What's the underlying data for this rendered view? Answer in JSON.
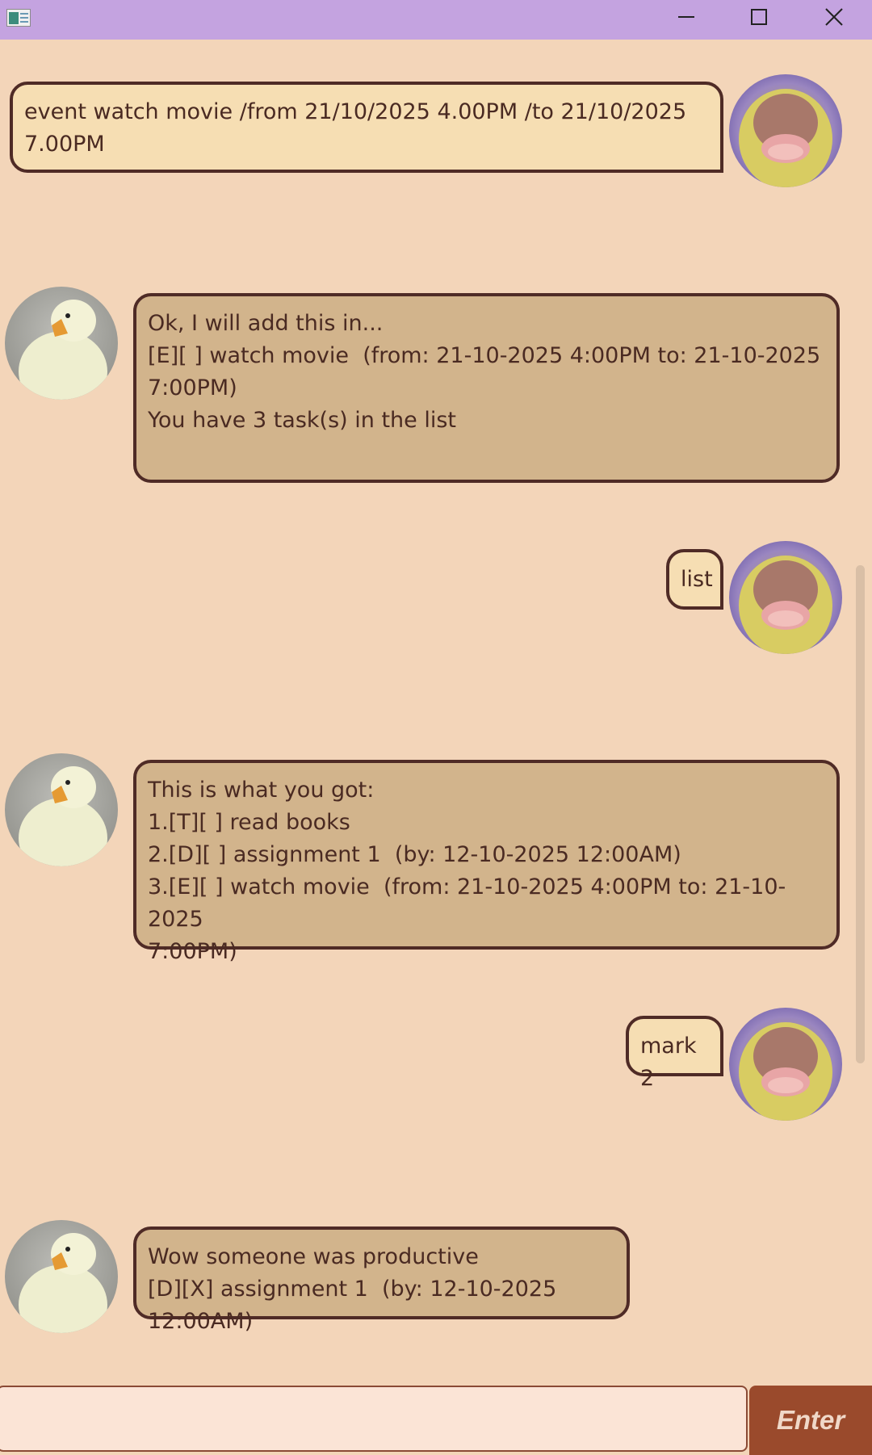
{
  "window": {
    "minimize_icon": "minimize-icon",
    "maximize_icon": "maximize-icon",
    "close_icon": "close-icon"
  },
  "colors": {
    "titlebar": "#c4a3e0",
    "background": "#f3d5b9",
    "user_bubble": "#f6deb3",
    "bot_bubble": "#d2b48c",
    "bubble_border": "#4f2b26",
    "enter_button": "#9a4a2c"
  },
  "messages": [
    {
      "sender": "user",
      "text": "event watch movie /from 21/10/2025 4.00PM /to 21/10/2025\n7.00PM"
    },
    {
      "sender": "bot",
      "text": "Ok, I will add this in...\n[E][ ] watch movie  (from: 21-10-2025 4:00PM to: 21-10-2025\n7:00PM)\nYou have 3 task(s) in the list\n"
    },
    {
      "sender": "user",
      "text": "list"
    },
    {
      "sender": "bot",
      "text": "This is what you got:\n1.[T][ ] read books\n2.[D][ ] assignment 1  (by: 12-10-2025 12:00AM)\n3.[E][ ] watch movie  (from: 21-10-2025 4:00PM to: 21-10-2025\n7:00PM)"
    },
    {
      "sender": "user",
      "text": "mark 2"
    },
    {
      "sender": "bot",
      "text": "Wow someone was productive\n[D][X] assignment 1  (by: 12-10-2025 12:00AM)"
    }
  ],
  "input": {
    "value": "",
    "placeholder": ""
  },
  "enter_button": {
    "label": "Enter"
  }
}
